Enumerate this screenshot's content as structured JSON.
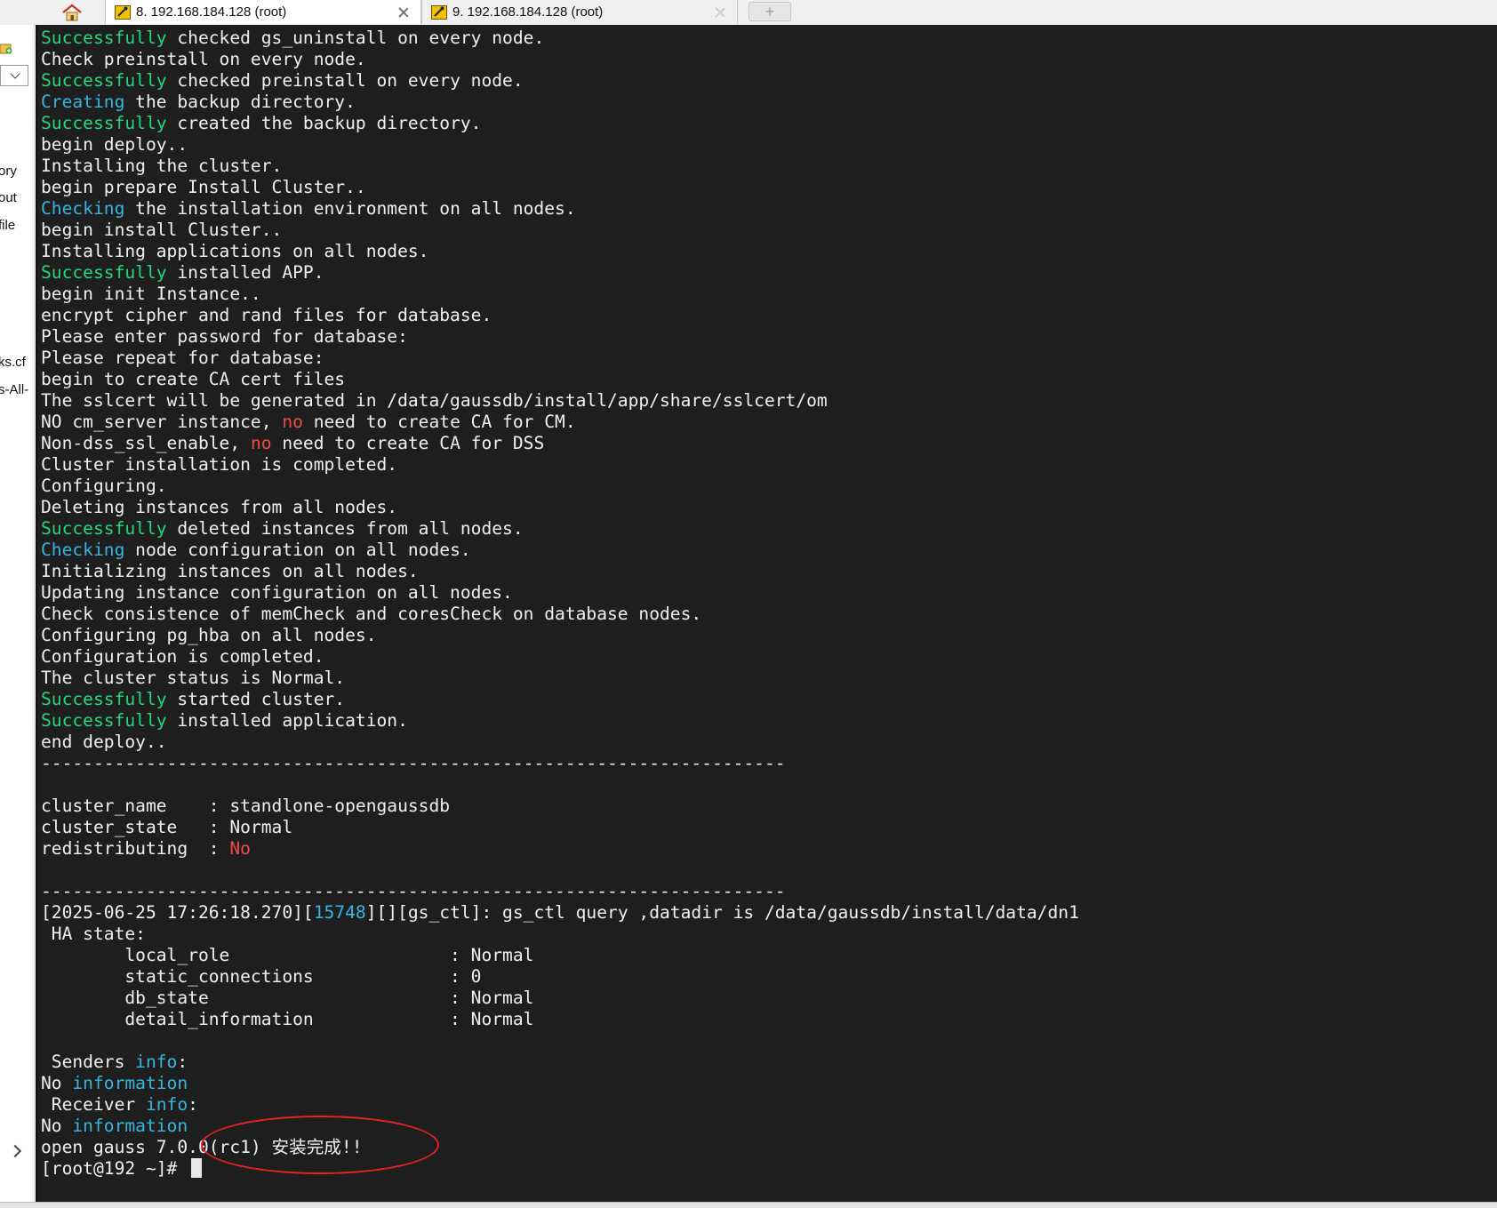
{
  "tabs": [
    {
      "title": "8. 192.168.184.128 (root)",
      "active": true
    },
    {
      "title": "9. 192.168.184.128 (root)",
      "active": false
    }
  ],
  "new_tab_icon": "+",
  "left_panel_items": [
    "ory",
    "out",
    "file",
    "ks.cf",
    "s-All-"
  ],
  "terminal": {
    "lines": [
      [
        {
          "t": "Successfully",
          "c": "green"
        },
        {
          "t": " checked gs_uninstall on every node.",
          "c": "normal"
        }
      ],
      [
        {
          "t": "Check preinstall on every node.",
          "c": "normal"
        }
      ],
      [
        {
          "t": "Successfully",
          "c": "green"
        },
        {
          "t": " checked preinstall on every node.",
          "c": "normal"
        }
      ],
      [
        {
          "t": "Creating",
          "c": "cyan"
        },
        {
          "t": " the backup directory.",
          "c": "normal"
        }
      ],
      [
        {
          "t": "Successfully",
          "c": "green"
        },
        {
          "t": " created the backup directory.",
          "c": "normal"
        }
      ],
      [
        {
          "t": "begin deploy..",
          "c": "normal"
        }
      ],
      [
        {
          "t": "Installing the cluster.",
          "c": "normal"
        }
      ],
      [
        {
          "t": "begin prepare Install Cluster..",
          "c": "normal"
        }
      ],
      [
        {
          "t": "Checking",
          "c": "cyan"
        },
        {
          "t": " the installation environment on all nodes.",
          "c": "normal"
        }
      ],
      [
        {
          "t": "begin install Cluster..",
          "c": "normal"
        }
      ],
      [
        {
          "t": "Installing applications on all nodes.",
          "c": "normal"
        }
      ],
      [
        {
          "t": "Successfully",
          "c": "green"
        },
        {
          "t": " installed APP.",
          "c": "normal"
        }
      ],
      [
        {
          "t": "begin init Instance..",
          "c": "normal"
        }
      ],
      [
        {
          "t": "encrypt cipher and rand files for database.",
          "c": "normal"
        }
      ],
      [
        {
          "t": "Please enter password for database:",
          "c": "normal"
        }
      ],
      [
        {
          "t": "Please repeat for database:",
          "c": "normal"
        }
      ],
      [
        {
          "t": "begin to create CA cert files",
          "c": "normal"
        }
      ],
      [
        {
          "t": "The sslcert will be generated in /data/gaussdb/install/app/share/sslcert/om",
          "c": "normal"
        }
      ],
      [
        {
          "t": "NO cm_server instance, ",
          "c": "normal"
        },
        {
          "t": "no",
          "c": "red"
        },
        {
          "t": " need to create CA for CM.",
          "c": "normal"
        }
      ],
      [
        {
          "t": "Non-dss_ssl_enable, ",
          "c": "normal"
        },
        {
          "t": "no",
          "c": "red"
        },
        {
          "t": " need to create CA for DSS",
          "c": "normal"
        }
      ],
      [
        {
          "t": "Cluster installation is completed.",
          "c": "normal"
        }
      ],
      [
        {
          "t": "Configuring.",
          "c": "normal"
        }
      ],
      [
        {
          "t": "Deleting instances from all nodes.",
          "c": "normal"
        }
      ],
      [
        {
          "t": "Successfully",
          "c": "green"
        },
        {
          "t": " deleted instances from all nodes.",
          "c": "normal"
        }
      ],
      [
        {
          "t": "Checking",
          "c": "cyan"
        },
        {
          "t": " node configuration on all nodes.",
          "c": "normal"
        }
      ],
      [
        {
          "t": "Initializing instances on all nodes.",
          "c": "normal"
        }
      ],
      [
        {
          "t": "Updating instance configuration on all nodes.",
          "c": "normal"
        }
      ],
      [
        {
          "t": "Check consistence of memCheck and coresCheck on database nodes.",
          "c": "normal"
        }
      ],
      [
        {
          "t": "Configuring pg_hba on all nodes.",
          "c": "normal"
        }
      ],
      [
        {
          "t": "Configuration is completed.",
          "c": "normal"
        }
      ],
      [
        {
          "t": "The cluster status is Normal.",
          "c": "normal"
        }
      ],
      [
        {
          "t": "Successfully",
          "c": "green"
        },
        {
          "t": " started cluster.",
          "c": "normal"
        }
      ],
      [
        {
          "t": "Successfully",
          "c": "green"
        },
        {
          "t": " installed application.",
          "c": "normal"
        }
      ],
      [
        {
          "t": "end deploy..",
          "c": "normal"
        }
      ],
      [
        {
          "t": "-----------------------------------------------------------------------",
          "c": "normal"
        }
      ],
      [],
      [
        {
          "t": "cluster_name    : standlone-opengaussdb",
          "c": "normal"
        }
      ],
      [
        {
          "t": "cluster_state   : Normal",
          "c": "normal"
        }
      ],
      [
        {
          "t": "redistributing  : ",
          "c": "normal"
        },
        {
          "t": "No",
          "c": "red"
        }
      ],
      [],
      [
        {
          "t": "-----------------------------------------------------------------------",
          "c": "normal"
        }
      ],
      [
        {
          "t": "[2025-06-25 17:26:18.270][",
          "c": "normal"
        },
        {
          "t": "15748",
          "c": "cyan"
        },
        {
          "t": "][][gs_ctl]: gs_ctl query ,datadir is /data/gaussdb/install/data/dn1",
          "c": "normal"
        }
      ],
      [
        {
          "t": " HA state:",
          "c": "normal"
        }
      ],
      [
        {
          "t": "        local_role                     : Normal",
          "c": "normal"
        }
      ],
      [
        {
          "t": "        static_connections             : 0",
          "c": "normal"
        }
      ],
      [
        {
          "t": "        db_state                       : Normal",
          "c": "normal"
        }
      ],
      [
        {
          "t": "        detail_information             : Normal",
          "c": "normal"
        }
      ],
      [],
      [
        {
          "t": " Senders ",
          "c": "normal"
        },
        {
          "t": "info",
          "c": "cyan"
        },
        {
          "t": ":",
          "c": "normal"
        }
      ],
      [
        {
          "t": "No ",
          "c": "normal"
        },
        {
          "t": "information",
          "c": "cyan"
        }
      ],
      [
        {
          "t": " Receiver ",
          "c": "normal"
        },
        {
          "t": "info",
          "c": "cyan"
        },
        {
          "t": ":",
          "c": "normal"
        }
      ],
      [
        {
          "t": "No ",
          "c": "normal"
        },
        {
          "t": "information",
          "c": "cyan"
        }
      ],
      [
        {
          "t": "open gauss 7.0.0(rc1) 安装完成!!",
          "c": "normal"
        }
      ]
    ],
    "prompt": "[root@192 ~]# "
  },
  "colors": {
    "terminal_bg": "#1e1e1e",
    "text": "#f0f0f0",
    "success_green": "#24d67e",
    "info_cyan": "#35b6e0",
    "warn_red": "#ef4b4b",
    "annotation_red": "#e3241b"
  },
  "icons": {
    "home_tab": "home-icon",
    "session_tab": "terminal-session-icon",
    "close": "close-icon",
    "new_tab": "add-tab-icon"
  }
}
